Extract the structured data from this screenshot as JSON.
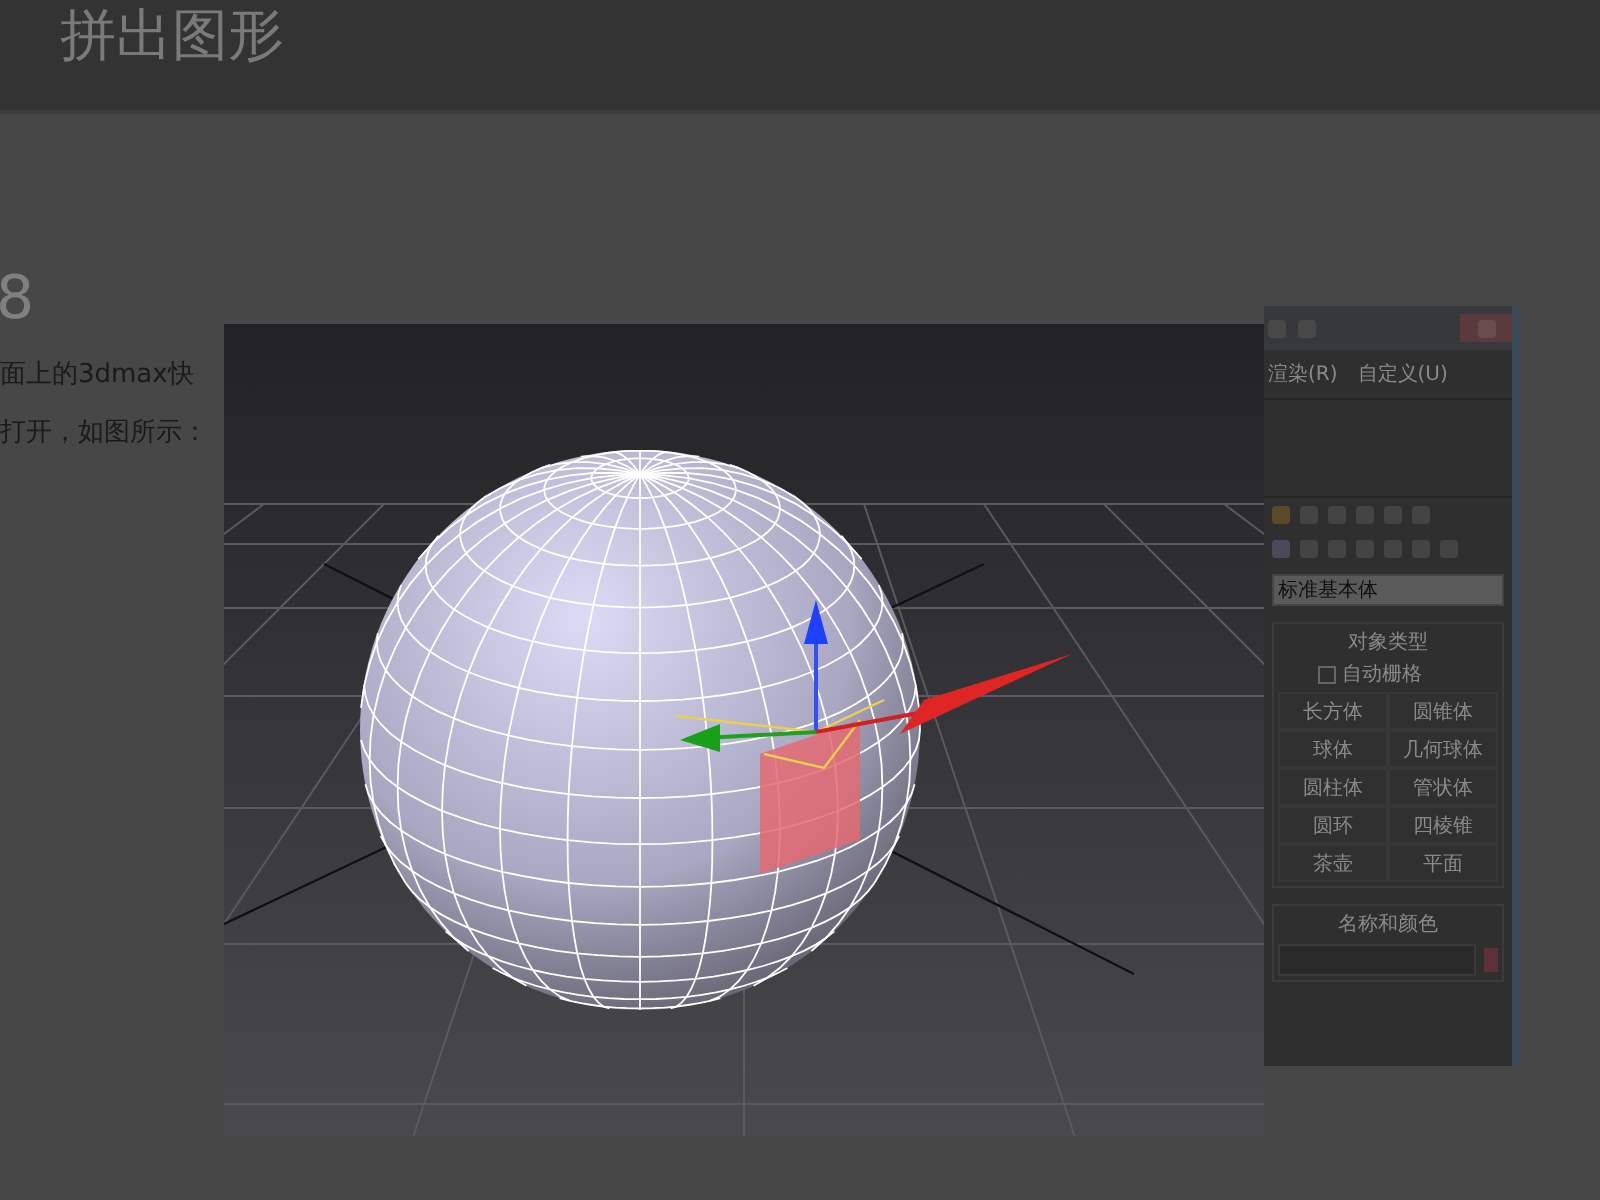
{
  "header": {
    "title": "拼出图形"
  },
  "step": {
    "number": "8",
    "lines": [
      "面上的3dmax快",
      "打开，如图所示："
    ]
  },
  "app_window": {
    "menu": [
      "渲染(R)",
      "自定义(U)"
    ],
    "category_dropdown": "标准基本体",
    "object_type": {
      "title": "对象类型",
      "autogrid": {
        "label": "自动栅格",
        "checked": false
      },
      "buttons": [
        "长方体",
        "圆锥体",
        "球体",
        "几何球体",
        "圆柱体",
        "管状体",
        "圆环",
        "四棱锥",
        "茶壶",
        "平面"
      ]
    },
    "name_color": {
      "title": "名称和颜色"
    }
  }
}
